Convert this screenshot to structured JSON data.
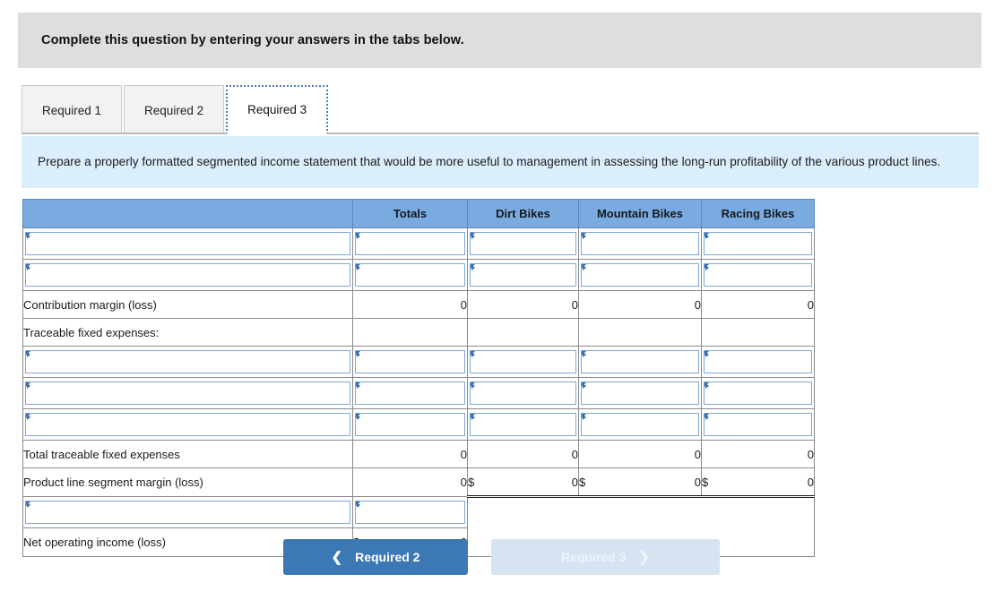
{
  "banner": {
    "title": "Complete this question by entering your answers in the tabs below."
  },
  "tabs": [
    {
      "label": "Required 1",
      "active": false
    },
    {
      "label": "Required 2",
      "active": false
    },
    {
      "label": "Required 3",
      "active": true
    }
  ],
  "instructions": {
    "text": "Prepare a properly formatted segmented income statement that would be more useful to management in assessing the long-run profitability of the various product lines."
  },
  "table": {
    "columns": [
      "",
      "Totals",
      "Dirt Bikes",
      "Mountain Bikes",
      "Racing Bikes"
    ],
    "rows": [
      {
        "label": "",
        "type": "input",
        "cells": [
          {
            "type": "input"
          },
          {
            "type": "input"
          },
          {
            "type": "input"
          },
          {
            "type": "input"
          }
        ]
      },
      {
        "label": "",
        "type": "input",
        "cells": [
          {
            "type": "input"
          },
          {
            "type": "input"
          },
          {
            "type": "input"
          },
          {
            "type": "input"
          }
        ]
      },
      {
        "label": "Contribution margin (loss)",
        "type": "value",
        "cells": [
          {
            "type": "value",
            "currency": "",
            "value": "0"
          },
          {
            "type": "value",
            "currency": "",
            "value": "0"
          },
          {
            "type": "value",
            "currency": "",
            "value": "0"
          },
          {
            "type": "value",
            "currency": "",
            "value": "0"
          }
        ]
      },
      {
        "label": "Traceable fixed expenses:",
        "type": "value",
        "cells": [
          {
            "type": "value",
            "currency": "",
            "value": ""
          },
          {
            "type": "value",
            "currency": "",
            "value": ""
          },
          {
            "type": "value",
            "currency": "",
            "value": ""
          },
          {
            "type": "value",
            "currency": "",
            "value": ""
          }
        ]
      },
      {
        "label": "",
        "type": "input",
        "cells": [
          {
            "type": "input"
          },
          {
            "type": "input"
          },
          {
            "type": "input"
          },
          {
            "type": "input"
          }
        ]
      },
      {
        "label": "",
        "type": "input",
        "cells": [
          {
            "type": "input"
          },
          {
            "type": "input"
          },
          {
            "type": "input"
          },
          {
            "type": "input"
          }
        ]
      },
      {
        "label": "",
        "type": "input",
        "cells": [
          {
            "type": "input"
          },
          {
            "type": "input"
          },
          {
            "type": "input"
          },
          {
            "type": "input"
          }
        ]
      },
      {
        "label": "Total traceable fixed expenses",
        "type": "value",
        "cells": [
          {
            "type": "value",
            "currency": "",
            "value": "0"
          },
          {
            "type": "value",
            "currency": "",
            "value": "0"
          },
          {
            "type": "value",
            "currency": "",
            "value": "0"
          },
          {
            "type": "value",
            "currency": "",
            "value": "0"
          }
        ]
      },
      {
        "label": "Product line segment margin (loss)",
        "type": "value",
        "cells": [
          {
            "type": "value",
            "currency": "",
            "value": "0"
          },
          {
            "type": "value",
            "currency": "$",
            "value": "0"
          },
          {
            "type": "value",
            "currency": "$",
            "value": "0"
          },
          {
            "type": "value",
            "currency": "$",
            "value": "0"
          }
        ]
      },
      {
        "label": "",
        "type": "input-totals-only",
        "cells": [
          {
            "type": "input"
          }
        ]
      },
      {
        "label": "Net operating income (loss)",
        "type": "value-totals-only",
        "cells": [
          {
            "type": "value",
            "currency": "$",
            "value": "0"
          }
        ]
      }
    ]
  },
  "nav": {
    "prev_label": "Required 2",
    "prev_icon": "chevron-left-icon",
    "next_label": "Required 3",
    "next_icon": "chevron-right-icon"
  },
  "colors": {
    "banner_bg": "#dedede",
    "instructions_bg": "#dbeefc",
    "table_header_bg": "#7aabe0",
    "prev_button_bg": "#3c78b4",
    "next_button_bg": "#d6e4f2",
    "field_border": "#7da7d5",
    "field_marker": "#3a6fb0"
  }
}
